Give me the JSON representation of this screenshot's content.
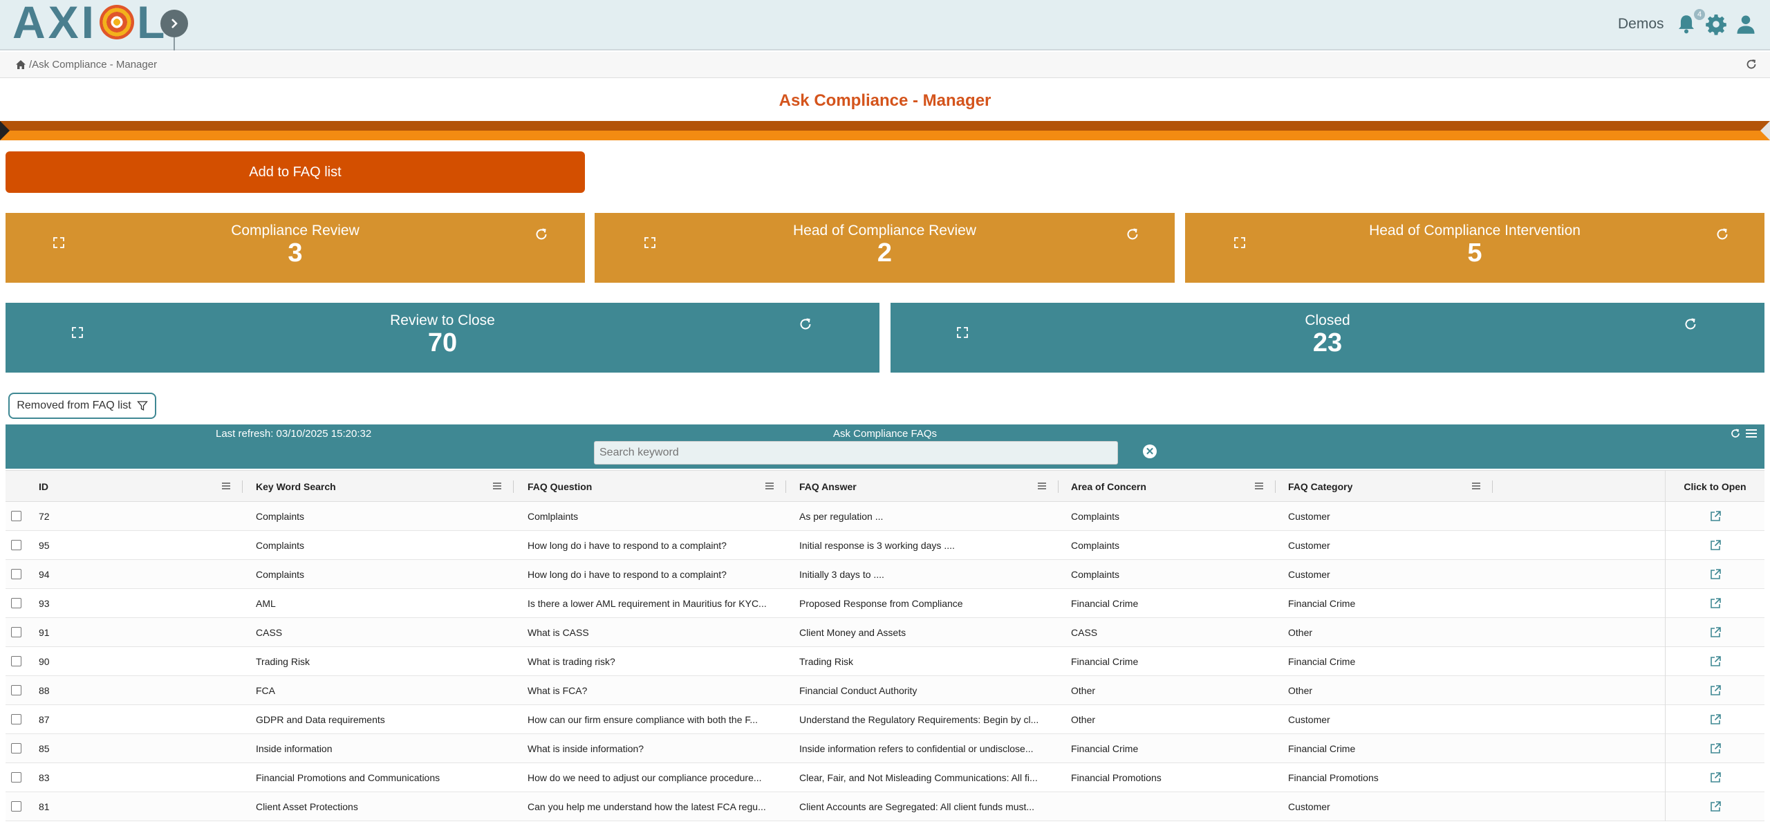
{
  "app": {
    "logo_text_a": "AXI",
    "logo_text_b": "L",
    "user_name": "Demos",
    "notification_count": "4",
    "icons": [
      "bell-icon",
      "gear-icon",
      "user-icon",
      "home-icon",
      "refresh-icon"
    ]
  },
  "breadcrumb": {
    "separator": "/",
    "current": "Ask Compliance - Manager"
  },
  "page": {
    "title": "Ask Compliance - Manager",
    "add_button_label": "Add to FAQ list"
  },
  "status_cards": [
    {
      "title": "Compliance Review",
      "value": "3",
      "color": "#d6922e"
    },
    {
      "title": "Head of Compliance Review",
      "value": "2",
      "color": "#d6922e"
    },
    {
      "title": "Head of Compliance Intervention",
      "value": "5",
      "color": "#d6922e"
    },
    {
      "title": "Review to Close",
      "value": "70",
      "color": "#3f8893"
    },
    {
      "title": "Closed",
      "value": "23",
      "color": "#3f8893"
    }
  ],
  "filter_button": {
    "label": "Removed from FAQ list"
  },
  "grid": {
    "last_refresh": "Last refresh: 03/10/2025 15:20:32",
    "title": "Ask Compliance FAQs",
    "search_placeholder": "Search keyword",
    "columns": [
      "ID",
      "Key Word Search",
      "FAQ Question",
      "FAQ Answer",
      "Area of Concern",
      "FAQ Category",
      "Click to Open"
    ],
    "rows": [
      {
        "id": "72",
        "keyword": "Complaints",
        "question": "Comlplaints",
        "answer": "As per regulation ...",
        "area": "Complaints",
        "category": "Customer"
      },
      {
        "id": "95",
        "keyword": "Complaints",
        "question": "How long do i have to respond to a complaint?",
        "answer": "Initial response is 3 working days ....",
        "area": "Complaints",
        "category": "Customer"
      },
      {
        "id": "94",
        "keyword": "Complaints",
        "question": "How long do i have to respond to a complaint?",
        "answer": "Initially 3 days to ....",
        "area": "Complaints",
        "category": "Customer"
      },
      {
        "id": "93",
        "keyword": "AML",
        "question": "Is there a lower AML requirement in Mauritius for KYC...",
        "answer": "Proposed Response from Compliance",
        "area": "Financial Crime",
        "category": "Financial Crime"
      },
      {
        "id": "91",
        "keyword": "CASS",
        "question": "What is CASS",
        "answer": "Client Money and Assets",
        "area": "CASS",
        "category": "Other"
      },
      {
        "id": "90",
        "keyword": "Trading Risk",
        "question": "What is trading risk?",
        "answer": "Trading Risk",
        "area": "Financial Crime",
        "category": "Financial Crime"
      },
      {
        "id": "88",
        "keyword": "FCA",
        "question": "What is FCA?",
        "answer": "Financial Conduct Authority",
        "area": "Other",
        "category": "Other"
      },
      {
        "id": "87",
        "keyword": "GDPR and Data requirements",
        "question": "How can our firm ensure compliance with both the F...",
        "answer": "Understand the Regulatory Requirements: Begin by cl...",
        "area": "Other",
        "category": "Customer"
      },
      {
        "id": "85",
        "keyword": "Inside information",
        "question": "What is inside information?",
        "answer": "Inside information refers to confidential or undisclose...",
        "area": "Financial Crime",
        "category": "Financial Crime"
      },
      {
        "id": "83",
        "keyword": "Financial Promotions and Communications",
        "question": "How do we need to adjust our compliance procedure...",
        "answer": "Clear, Fair, and Not Misleading Communications: All fi...",
        "area": "Financial Promotions",
        "category": "Financial Promotions"
      },
      {
        "id": "81",
        "keyword": "Client Asset Protections",
        "question": "Can you help me understand how the latest FCA regu...",
        "answer": "Client Accounts are Segregated: All client funds must...",
        "area": "",
        "category": "Customer"
      }
    ]
  }
}
